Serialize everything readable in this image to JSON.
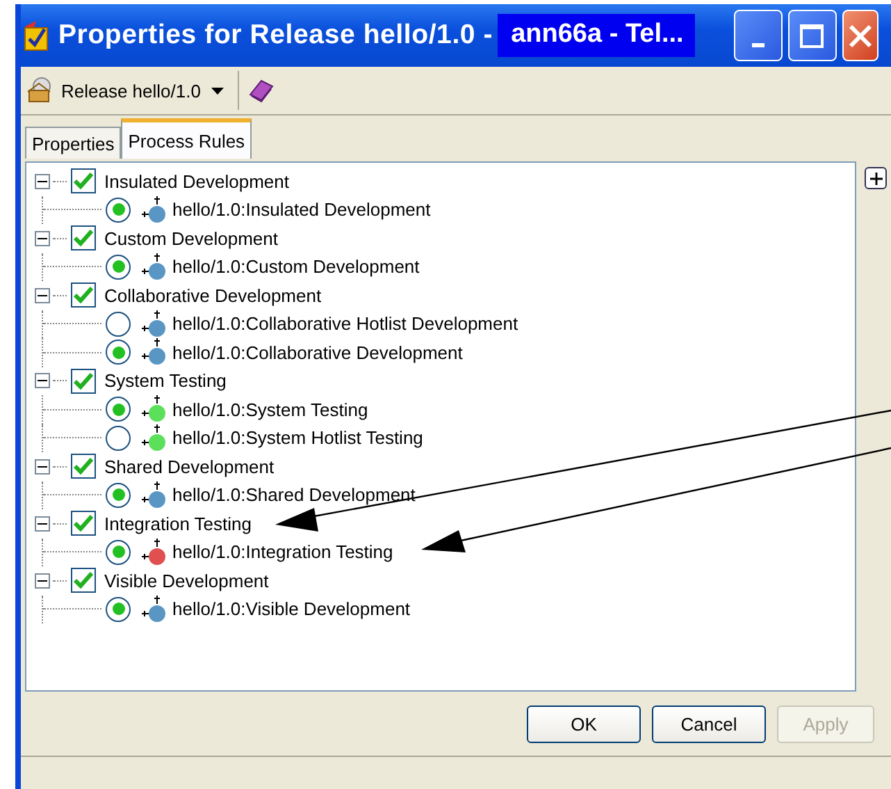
{
  "window": {
    "title": "Properties for Release hello/1.0 -",
    "title_overlay": "ann66a - Tel..."
  },
  "toolbar": {
    "release_menu": "Release hello/1.0"
  },
  "tabs": [
    {
      "label": "Properties",
      "selected": false
    },
    {
      "label": "Process Rules",
      "selected": true
    }
  ],
  "tree": [
    {
      "label": "Insulated Development",
      "expanded": true,
      "checked": true,
      "children": [
        {
          "label": "hello/1.0:Insulated Development",
          "selected": true,
          "color": "#5a96c3"
        }
      ]
    },
    {
      "label": "Custom Development",
      "expanded": true,
      "checked": true,
      "children": [
        {
          "label": "hello/1.0:Custom Development",
          "selected": true,
          "color": "#5a96c3"
        }
      ]
    },
    {
      "label": "Collaborative Development",
      "expanded": true,
      "checked": true,
      "children": [
        {
          "label": "hello/1.0:Collaborative Hotlist Development",
          "selected": false,
          "color": "#5a96c3"
        },
        {
          "label": "hello/1.0:Collaborative Development",
          "selected": true,
          "color": "#5a96c3"
        }
      ]
    },
    {
      "label": "System Testing",
      "expanded": true,
      "checked": true,
      "children": [
        {
          "label": "hello/1.0:System Testing",
          "selected": true,
          "color": "#5ce05c"
        },
        {
          "label": "hello/1.0:System Hotlist Testing",
          "selected": false,
          "color": "#5ce05c"
        }
      ]
    },
    {
      "label": "Shared Development",
      "expanded": true,
      "checked": true,
      "children": [
        {
          "label": "hello/1.0:Shared Development",
          "selected": true,
          "color": "#5a96c3"
        }
      ]
    },
    {
      "label": "Integration Testing",
      "expanded": true,
      "checked": true,
      "children": [
        {
          "label": "hello/1.0:Integration Testing",
          "selected": true,
          "color": "#e05050"
        }
      ]
    },
    {
      "label": "Visible Development",
      "expanded": true,
      "checked": true,
      "children": [
        {
          "label": "hello/1.0:Visible Development",
          "selected": true,
          "color": "#5a96c3"
        }
      ]
    }
  ],
  "buttons": [
    {
      "label": "OK",
      "disabled": false
    },
    {
      "label": "Cancel",
      "disabled": false
    },
    {
      "label": "Apply",
      "disabled": true
    }
  ]
}
